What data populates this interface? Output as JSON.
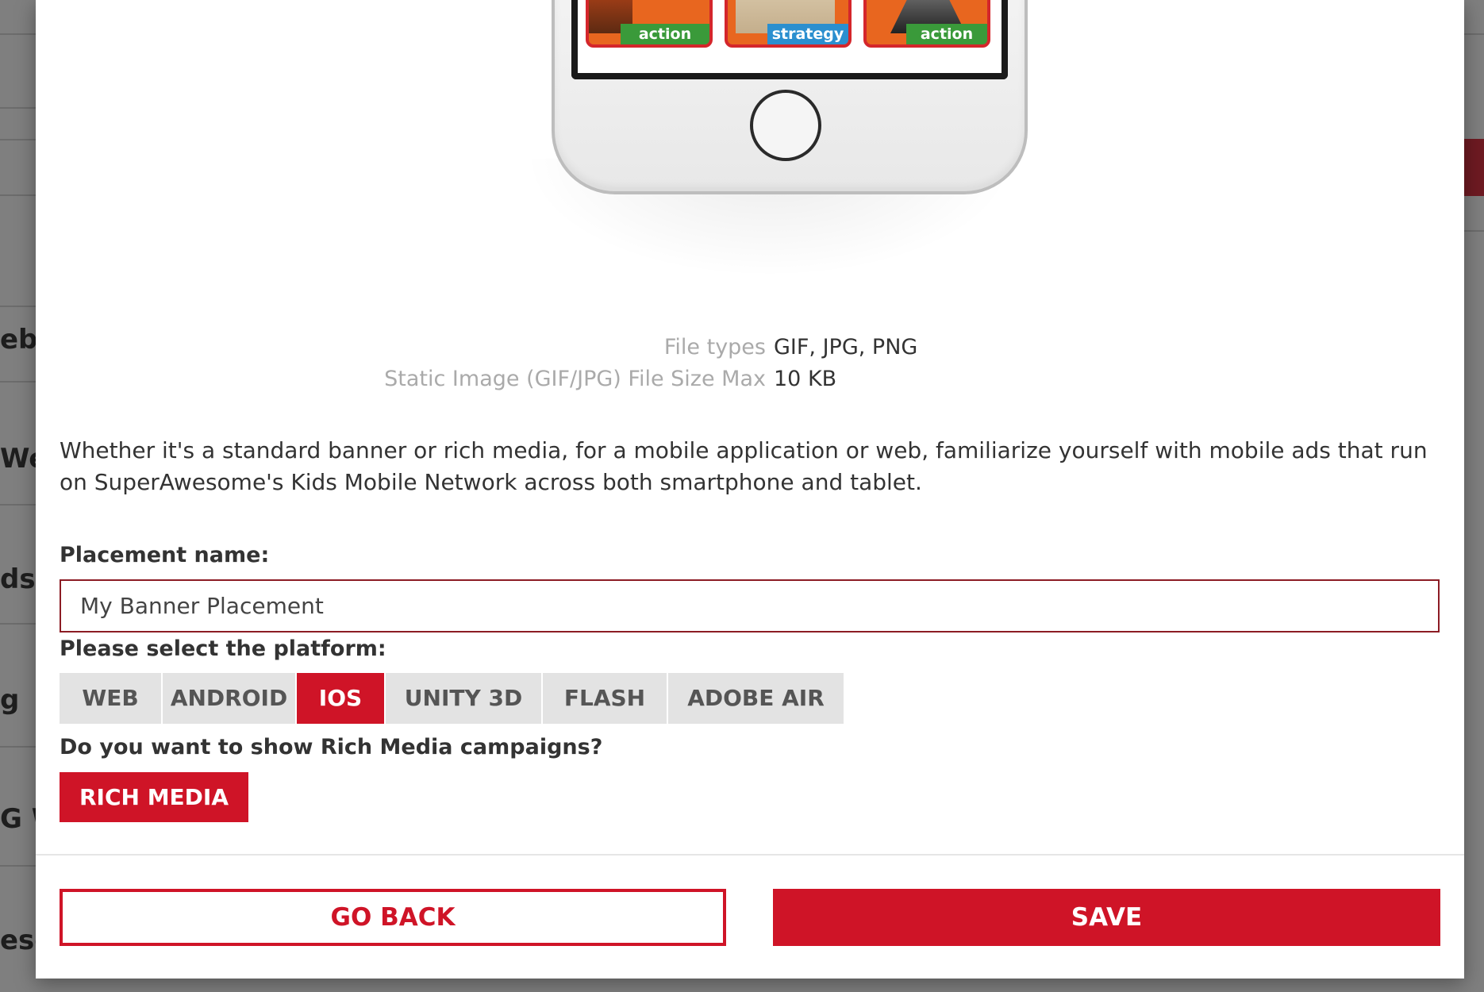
{
  "background": {
    "fragments": [
      "ebsi",
      "We",
      "dsh",
      "g",
      "G W",
      "esc"
    ]
  },
  "preview": {
    "tiles": [
      "action",
      "strategy",
      "action"
    ]
  },
  "file_info": {
    "file_types_label": "File types",
    "file_types_value": "GIF, JPG, PNG",
    "size_max_label": "Static Image (GIF/JPG) File Size Max",
    "size_max_value": "10 KB"
  },
  "description": "Whether it's a standard banner or rich media, for a mobile application or web, familiarize yourself with mobile ads that run on SuperAwesome's Kids Mobile Network across both smartphone and tablet.",
  "placement": {
    "label": "Placement name:",
    "value": "My Banner Placement"
  },
  "platform": {
    "label": "Please select the platform:",
    "options": [
      "WEB",
      "ANDROID",
      "IOS",
      "UNITY 3D",
      "FLASH",
      "ADOBE AIR"
    ],
    "selected": "IOS"
  },
  "rich_media": {
    "question": "Do you want to show Rich Media campaigns?",
    "button_label": "RICH MEDIA"
  },
  "footer": {
    "go_back_label": "GO BACK",
    "save_label": "SAVE"
  },
  "colors": {
    "accent": "#cf1427",
    "input_border": "#8c1c24",
    "inactive_tab": "#e3e3e3"
  }
}
